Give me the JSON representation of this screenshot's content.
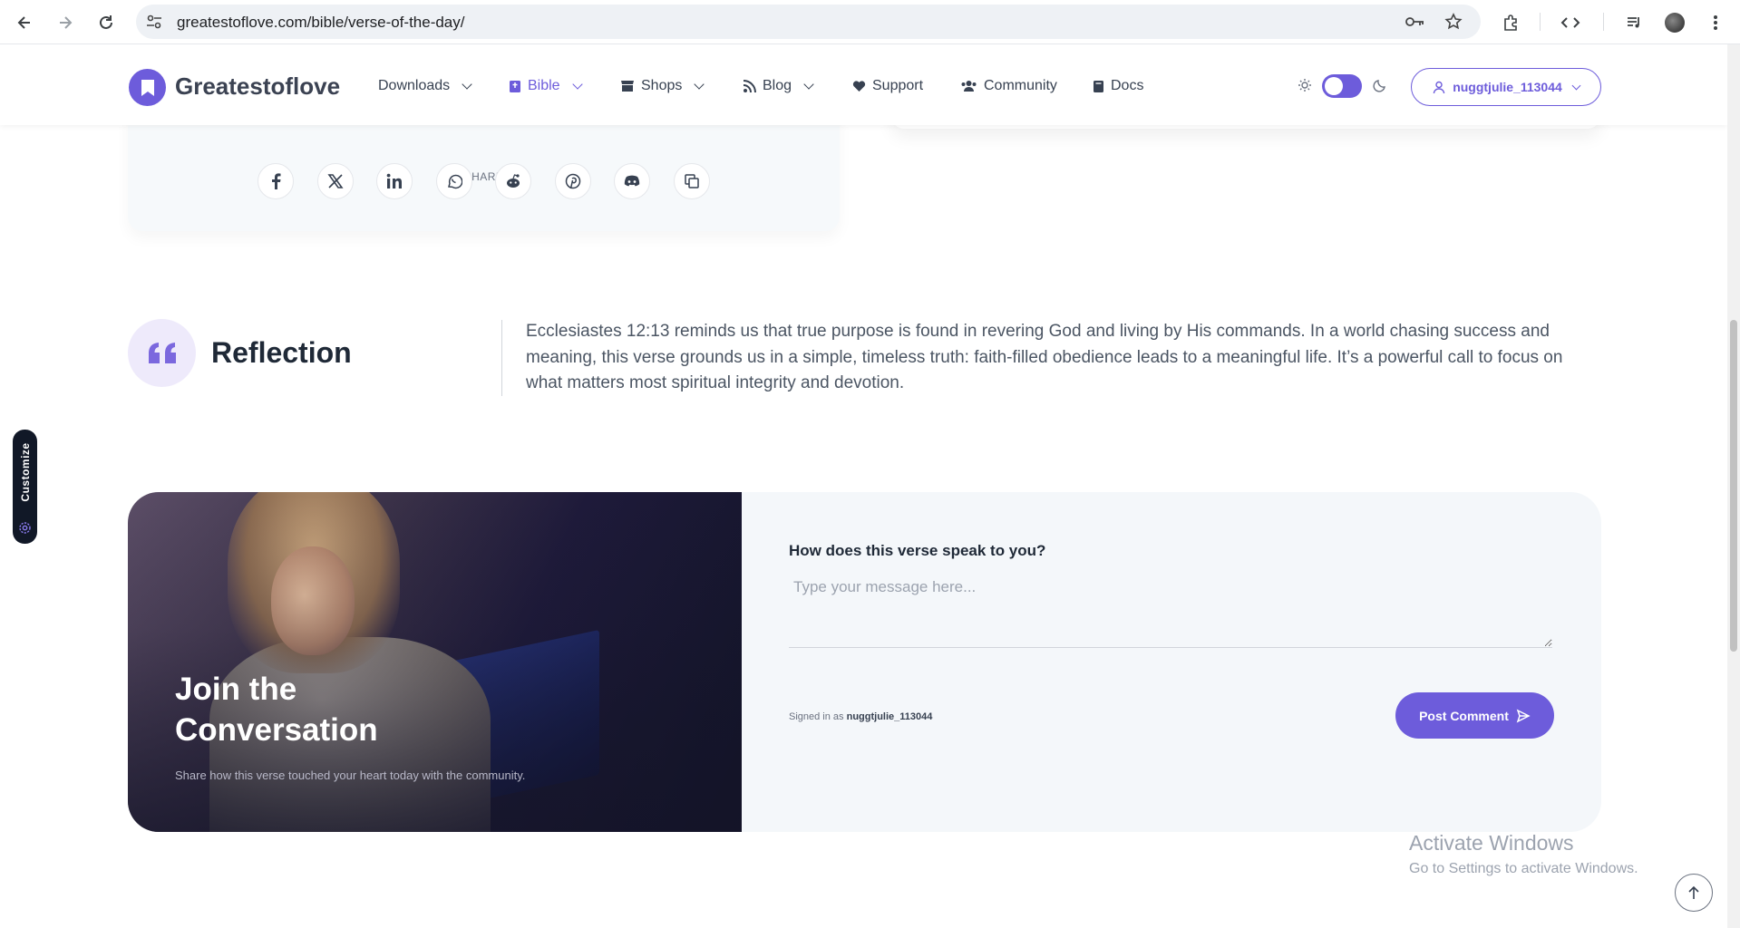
{
  "browser": {
    "url": "greatestoflove.com/bible/verse-of-the-day/"
  },
  "navbar": {
    "brand": "Greatestoflove",
    "items": [
      {
        "label": "Downloads",
        "icon": "none"
      },
      {
        "label": "Bible",
        "icon": "book-icon"
      },
      {
        "label": "Shops",
        "icon": "store-icon"
      },
      {
        "label": "Blog",
        "icon": "rss-icon"
      },
      {
        "label": "Support",
        "icon": "heart-icon"
      },
      {
        "label": "Community",
        "icon": "users-icon"
      },
      {
        "label": "Docs",
        "icon": "book-icon"
      }
    ],
    "active_item": "Bible",
    "theme_toggle": "light-dark-toggle",
    "user": "nuggtjulie_113044"
  },
  "share": {
    "label": "SHARE",
    "buttons": [
      "facebook-icon",
      "x-icon",
      "linkedin-icon",
      "whatsapp-icon",
      "reddit-icon",
      "pinterest-icon",
      "discord-icon",
      "copy-icon"
    ]
  },
  "reflection": {
    "title": "Reflection",
    "text": "Ecclesiastes 12:13 reminds us that true purpose is found in revering God and living by His commands. In a world chasing success and meaning, this verse grounds us in a simple, timeless truth: faith-filled obedience leads to a meaningful life. It’s a powerful call to focus on what matters most spiritual integrity and devotion."
  },
  "join": {
    "title": "Join the Conversation",
    "subtitle": "Share how this verse touched your heart today with the community.",
    "question": "How does this verse speak to you?",
    "placeholder": "Type your message here...",
    "signed_in_prefix": "Signed in as",
    "signed_in_user": "nuggtjulie_113044",
    "post_button": "Post Comment"
  },
  "customize": {
    "label": "Customize"
  },
  "watermark": {
    "line1": "Activate Windows",
    "line2": "Go to Settings to activate Windows."
  },
  "colors": {
    "accent": "#6d5cdb",
    "panel_bg": "#f4f7fa"
  }
}
